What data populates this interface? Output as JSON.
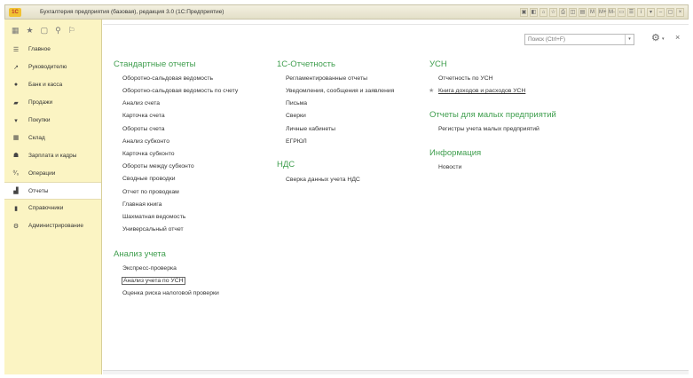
{
  "window": {
    "title": "Бухгалтерия предприятия (базовая), редакция 3.0  (1С:Предприятие)",
    "logo": "1C",
    "tools": [
      "▣",
      "◧",
      "⌂",
      "☆",
      "⎙",
      "◫",
      "▤",
      "M",
      "M+",
      "M-",
      "▭",
      "☰",
      "i",
      "▾",
      "–",
      "▢",
      "×"
    ]
  },
  "left_toolbar": [
    "▦",
    "★",
    "▢",
    "⚲",
    "⚐"
  ],
  "nav": [
    {
      "label": "Главное",
      "icon": "menu-lines-icon",
      "glyph": "☰"
    },
    {
      "label": "Руководителю",
      "icon": "trend-icon",
      "glyph": "↗"
    },
    {
      "label": "Банк и касса",
      "icon": "coins-icon",
      "glyph": "●"
    },
    {
      "label": "Продажи",
      "icon": "bag-icon",
      "glyph": "▰"
    },
    {
      "label": "Покупки",
      "icon": "cart-icon",
      "glyph": "▾"
    },
    {
      "label": "Склад",
      "icon": "warehouse-icon",
      "glyph": "▦"
    },
    {
      "label": "Зарплата и кадры",
      "icon": "person-icon",
      "glyph": "☗"
    },
    {
      "label": "Операции",
      "icon": "operations-icon",
      "glyph": "⁰⁄₀"
    },
    {
      "label": "Отчеты",
      "icon": "chart-icon",
      "glyph": "▟",
      "active": true
    },
    {
      "label": "Справочники",
      "icon": "book-icon",
      "glyph": "▮"
    },
    {
      "label": "Администрирование",
      "icon": "gear-icon",
      "glyph": "⚙"
    }
  ],
  "search": {
    "placeholder": "Поиск (Ctrl+F)",
    "dropdown": "▾"
  },
  "settings_glyph": "⚙",
  "settings_caret": "▾",
  "close_glyph": "×",
  "columns": {
    "standard": {
      "title": "Стандартные отчеты",
      "links": [
        "Оборотно-сальдовая ведомость",
        "Оборотно-сальдовая ведомость по счету",
        "Анализ счета",
        "Карточка счета",
        "Обороты счета",
        "Анализ субконто",
        "Карточка субконто",
        "Обороты между субконто",
        "Сводные проводки",
        "Отчет по проводкам",
        "Главная книга",
        "Шахматная ведомость",
        "Универсальный отчет"
      ]
    },
    "analysis": {
      "title": "Анализ учета",
      "links": [
        "Экспресс-проверка",
        "Анализ учета по УСН",
        "Оценка риска налоговой проверки"
      ]
    },
    "reporting": {
      "title": "1С-Отчетность",
      "links": [
        "Регламентированные отчеты",
        "Уведомления, сообщения и заявления",
        "Письма",
        "Сверки",
        "Личные кабинеты",
        "ЕГРЮЛ"
      ]
    },
    "vat": {
      "title": "НДС",
      "links": [
        "Сверка данных учета НДС"
      ]
    },
    "usn": {
      "title": "УСН",
      "links": [
        "Отчетность по УСН",
        "Книга доходов и расходов УСН"
      ],
      "star": "★"
    },
    "small": {
      "title": "Отчеты для малых предприятий",
      "links": [
        "Регистры учета малых предприятий"
      ]
    },
    "info": {
      "title": "Информация",
      "links": [
        "Новости"
      ]
    }
  },
  "colors": {
    "section_title": "#3f9e4e",
    "panel_bg": "#fbf4c3"
  }
}
